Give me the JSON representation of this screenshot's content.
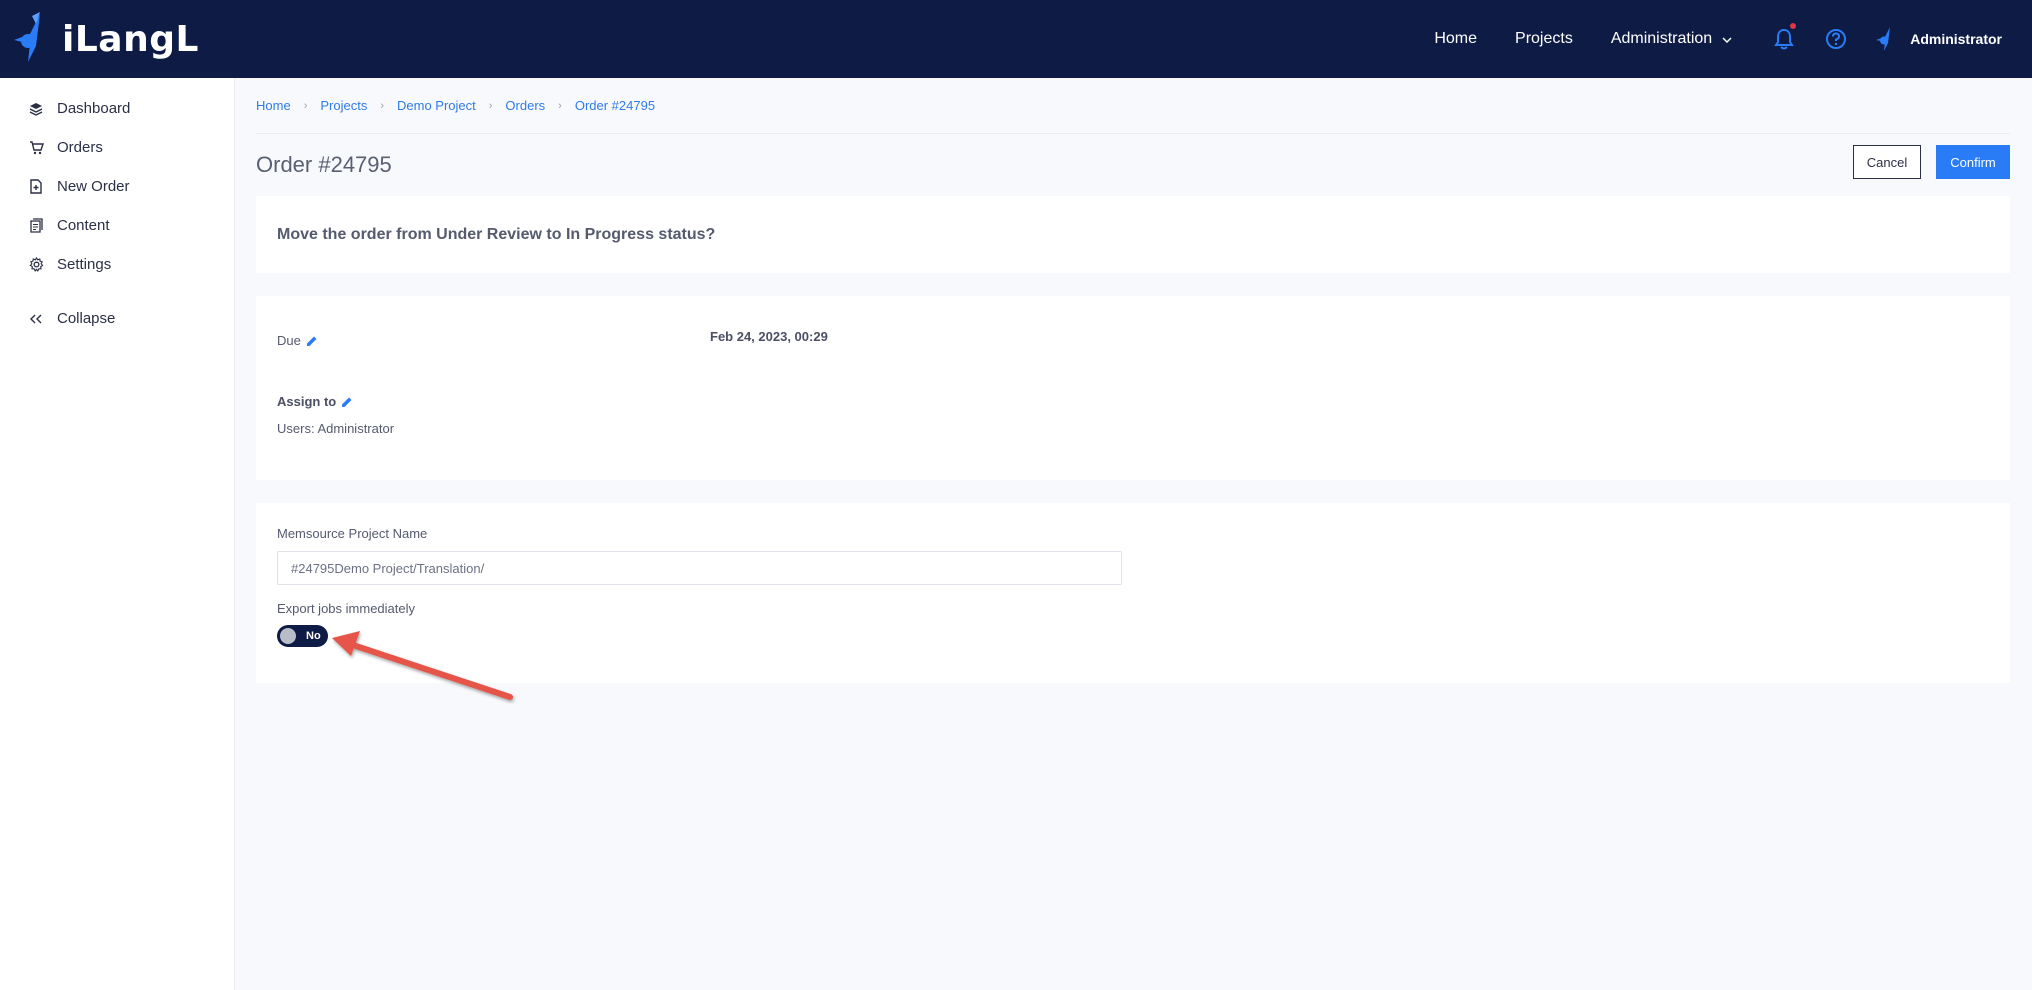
{
  "app": {
    "logo_text": "iLangL"
  },
  "topnav": {
    "items": [
      {
        "label": "Home"
      },
      {
        "label": "Projects"
      },
      {
        "label": "Administration"
      }
    ],
    "user_name": "Administrator"
  },
  "sidebar": {
    "items": [
      {
        "label": "Dashboard",
        "icon": "layers-icon"
      },
      {
        "label": "Orders",
        "icon": "cart-icon"
      },
      {
        "label": "New Order",
        "icon": "new-document-icon"
      },
      {
        "label": "Content",
        "icon": "documents-icon"
      },
      {
        "label": "Settings",
        "icon": "gear-icon"
      }
    ],
    "collapse_label": "Collapse"
  },
  "breadcrumb": [
    "Home",
    "Projects",
    "Demo Project",
    "Orders",
    "Order #24795"
  ],
  "page": {
    "title": "Order #24795",
    "cancel_label": "Cancel",
    "confirm_label": "Confirm"
  },
  "question": "Move the order from Under Review to In Progress status?",
  "details": {
    "due_label": "Due",
    "due_value": "Feb 24, 2023, 00:29",
    "assign_label": "Assign to",
    "assign_value": "Users: Administrator"
  },
  "memsource": {
    "label": "Memsource Project Name",
    "value": "#24795Demo Project/Translation/",
    "export_label": "Export jobs immediately",
    "toggle_label": "No",
    "toggle_on": false
  },
  "colors": {
    "topbar": "#0d1b45",
    "accent": "#2a7cf6",
    "link": "#2f7ce8",
    "annotation_arrow": "#e5544a"
  }
}
